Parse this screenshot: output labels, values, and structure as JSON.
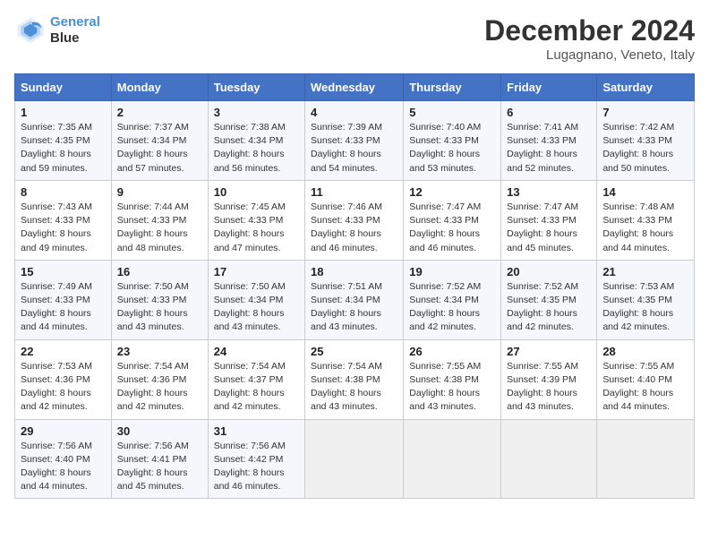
{
  "header": {
    "logo_line1": "General",
    "logo_line2": "Blue",
    "title": "December 2024",
    "subtitle": "Lugagnano, Veneto, Italy"
  },
  "calendar": {
    "days_of_week": [
      "Sunday",
      "Monday",
      "Tuesday",
      "Wednesday",
      "Thursday",
      "Friday",
      "Saturday"
    ],
    "weeks": [
      [
        {
          "day": "",
          "empty": true
        },
        {
          "day": "",
          "empty": true
        },
        {
          "day": "",
          "empty": true
        },
        {
          "day": "",
          "empty": true
        },
        {
          "day": "",
          "empty": true
        },
        {
          "day": "",
          "empty": true
        },
        {
          "day": "",
          "empty": true
        }
      ],
      [
        {
          "num": "1",
          "sunrise": "7:35 AM",
          "sunset": "4:35 PM",
          "daylight": "8 hours and 59 minutes."
        },
        {
          "num": "2",
          "sunrise": "7:37 AM",
          "sunset": "4:34 PM",
          "daylight": "8 hours and 57 minutes."
        },
        {
          "num": "3",
          "sunrise": "7:38 AM",
          "sunset": "4:34 PM",
          "daylight": "8 hours and 56 minutes."
        },
        {
          "num": "4",
          "sunrise": "7:39 AM",
          "sunset": "4:33 PM",
          "daylight": "8 hours and 54 minutes."
        },
        {
          "num": "5",
          "sunrise": "7:40 AM",
          "sunset": "4:33 PM",
          "daylight": "8 hours and 53 minutes."
        },
        {
          "num": "6",
          "sunrise": "7:41 AM",
          "sunset": "4:33 PM",
          "daylight": "8 hours and 52 minutes."
        },
        {
          "num": "7",
          "sunrise": "7:42 AM",
          "sunset": "4:33 PM",
          "daylight": "8 hours and 50 minutes."
        }
      ],
      [
        {
          "num": "8",
          "sunrise": "7:43 AM",
          "sunset": "4:33 PM",
          "daylight": "8 hours and 49 minutes."
        },
        {
          "num": "9",
          "sunrise": "7:44 AM",
          "sunset": "4:33 PM",
          "daylight": "8 hours and 48 minutes."
        },
        {
          "num": "10",
          "sunrise": "7:45 AM",
          "sunset": "4:33 PM",
          "daylight": "8 hours and 47 minutes."
        },
        {
          "num": "11",
          "sunrise": "7:46 AM",
          "sunset": "4:33 PM",
          "daylight": "8 hours and 46 minutes."
        },
        {
          "num": "12",
          "sunrise": "7:47 AM",
          "sunset": "4:33 PM",
          "daylight": "8 hours and 46 minutes."
        },
        {
          "num": "13",
          "sunrise": "7:47 AM",
          "sunset": "4:33 PM",
          "daylight": "8 hours and 45 minutes."
        },
        {
          "num": "14",
          "sunrise": "7:48 AM",
          "sunset": "4:33 PM",
          "daylight": "8 hours and 44 minutes."
        }
      ],
      [
        {
          "num": "15",
          "sunrise": "7:49 AM",
          "sunset": "4:33 PM",
          "daylight": "8 hours and 44 minutes."
        },
        {
          "num": "16",
          "sunrise": "7:50 AM",
          "sunset": "4:33 PM",
          "daylight": "8 hours and 43 minutes."
        },
        {
          "num": "17",
          "sunrise": "7:50 AM",
          "sunset": "4:34 PM",
          "daylight": "8 hours and 43 minutes."
        },
        {
          "num": "18",
          "sunrise": "7:51 AM",
          "sunset": "4:34 PM",
          "daylight": "8 hours and 43 minutes."
        },
        {
          "num": "19",
          "sunrise": "7:52 AM",
          "sunset": "4:34 PM",
          "daylight": "8 hours and 42 minutes."
        },
        {
          "num": "20",
          "sunrise": "7:52 AM",
          "sunset": "4:35 PM",
          "daylight": "8 hours and 42 minutes."
        },
        {
          "num": "21",
          "sunrise": "7:53 AM",
          "sunset": "4:35 PM",
          "daylight": "8 hours and 42 minutes."
        }
      ],
      [
        {
          "num": "22",
          "sunrise": "7:53 AM",
          "sunset": "4:36 PM",
          "daylight": "8 hours and 42 minutes."
        },
        {
          "num": "23",
          "sunrise": "7:54 AM",
          "sunset": "4:36 PM",
          "daylight": "8 hours and 42 minutes."
        },
        {
          "num": "24",
          "sunrise": "7:54 AM",
          "sunset": "4:37 PM",
          "daylight": "8 hours and 42 minutes."
        },
        {
          "num": "25",
          "sunrise": "7:54 AM",
          "sunset": "4:38 PM",
          "daylight": "8 hours and 43 minutes."
        },
        {
          "num": "26",
          "sunrise": "7:55 AM",
          "sunset": "4:38 PM",
          "daylight": "8 hours and 43 minutes."
        },
        {
          "num": "27",
          "sunrise": "7:55 AM",
          "sunset": "4:39 PM",
          "daylight": "8 hours and 43 minutes."
        },
        {
          "num": "28",
          "sunrise": "7:55 AM",
          "sunset": "4:40 PM",
          "daylight": "8 hours and 44 minutes."
        }
      ],
      [
        {
          "num": "29",
          "sunrise": "7:56 AM",
          "sunset": "4:40 PM",
          "daylight": "8 hours and 44 minutes."
        },
        {
          "num": "30",
          "sunrise": "7:56 AM",
          "sunset": "4:41 PM",
          "daylight": "8 hours and 45 minutes."
        },
        {
          "num": "31",
          "sunrise": "7:56 AM",
          "sunset": "4:42 PM",
          "daylight": "8 hours and 46 minutes."
        },
        {
          "day": "",
          "empty": true
        },
        {
          "day": "",
          "empty": true
        },
        {
          "day": "",
          "empty": true
        },
        {
          "day": "",
          "empty": true
        }
      ]
    ],
    "labels": {
      "sunrise": "Sunrise:",
      "sunset": "Sunset:",
      "daylight": "Daylight:"
    }
  }
}
